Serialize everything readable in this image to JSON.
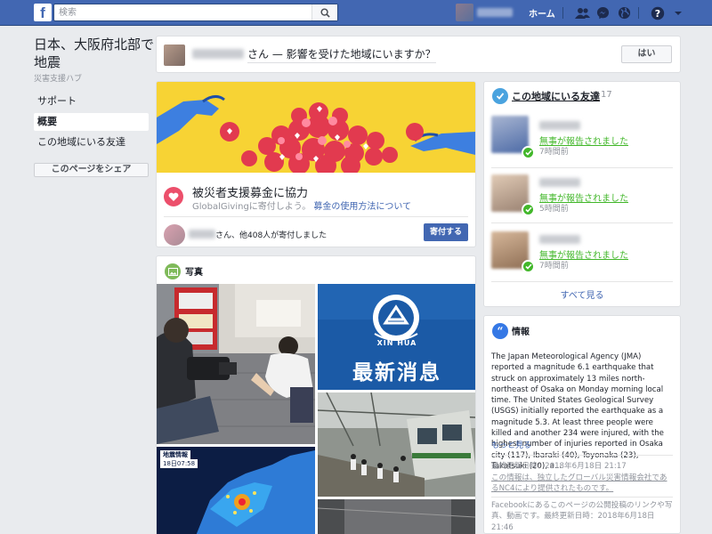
{
  "topbar": {
    "logo": "f",
    "search_placeholder": "検索",
    "home": "ホーム",
    "icons": [
      "friend-requests-icon",
      "messenger-icon",
      "globe-icon",
      "help-icon",
      "dropdown-arrow-icon"
    ]
  },
  "sidebar": {
    "title": "日本、大阪府北部で地震",
    "subtitle": "災害支援ハブ",
    "items": [
      {
        "label": "サポート",
        "active": false
      },
      {
        "label": "概要",
        "active": true
      },
      {
        "label": "この地域にいる友達",
        "active": false
      }
    ],
    "share_button": "このページをシェア"
  },
  "question": {
    "text": "さん — 影響を受けた地域にいますか？",
    "yes_button": "はい"
  },
  "fundraiser": {
    "title": "被災者支援募金に協力",
    "subtitle": "GlobalGivingに寄付しよう。",
    "link": "募金の使用方法について",
    "donors_text": "さん、他408人が寄付しました",
    "donate_button": "寄付する"
  },
  "photos": {
    "title": "写真",
    "xinhua_en": "XIN HUA",
    "xinhua_news": "最新消息",
    "quake_label": "地震情報",
    "quake_time": "18日07:58"
  },
  "friends": {
    "title": "この地域にいる友達",
    "count": "17",
    "list": [
      {
        "status": "無事が報告されました",
        "time": "7時間前"
      },
      {
        "status": "無事が報告されました",
        "time": "5時間前"
      },
      {
        "status": "無事が報告されました",
        "time": "7時間前"
      }
    ],
    "see_all": "すべて見る"
  },
  "info": {
    "title": "情報",
    "body": "The Japan Meteorological Agency (JMA) reported a magnitude 6.1 earthquake that struck on approximately 13 miles north-northeast of Osaka on Monday morning local time. The United States Geological Survey (USGS) initially reported the earthquake as a magnitude 5.3. At least three people were killed and another 234 were injured, with the highest number of injuries reported in Osaka city (117), Ibaraki (40), Toyonaka (23), Takatsuki (20), a...",
    "more": "もっと見る",
    "updated": "最終更新日時：2018年6月18日 21:17",
    "provider": "この情報は、独立したグローバル災害情報会社であるNC4により提供されたものです。",
    "footer": "Facebookにあるこのページの公開投稿のリンクや写真、動画です。最終更新日時：2018年6月18日 21:46"
  }
}
